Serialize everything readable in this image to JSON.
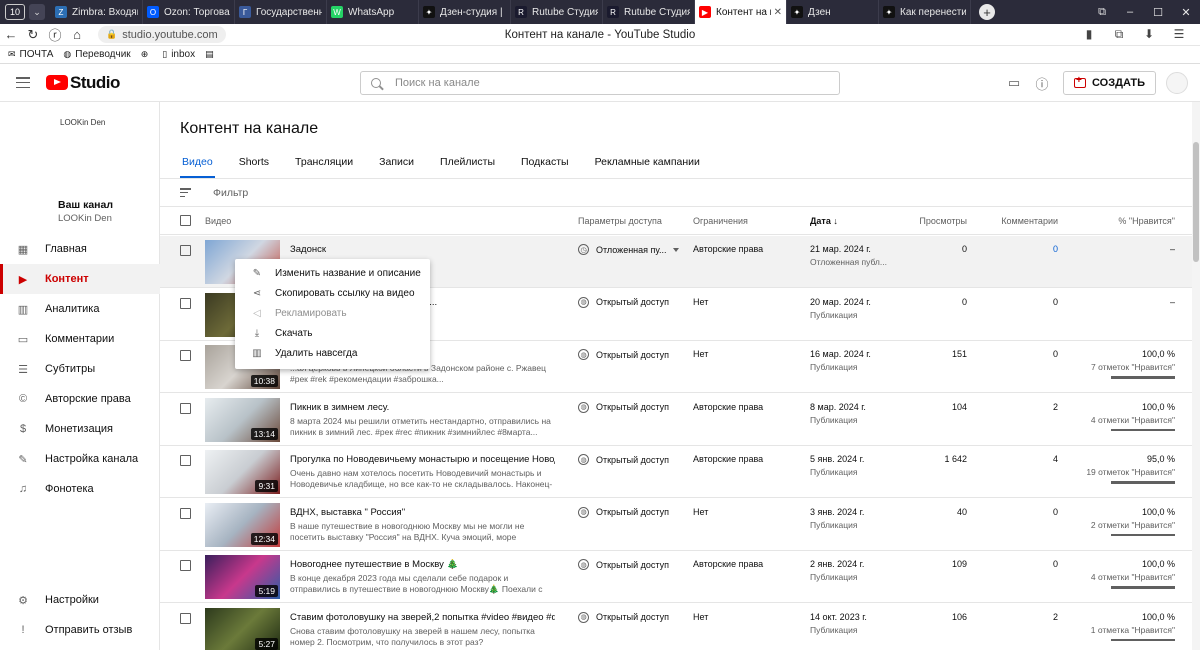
{
  "browser": {
    "tab_count": "10",
    "tabs": [
      {
        "label": "Zimbra: Входящи",
        "fav_color": "#2c6fb5",
        "fav_glyph": "Z",
        "active": false
      },
      {
        "label": "Ozon: Торговая п",
        "fav_color": "#005bff",
        "fav_glyph": "O",
        "active": false
      },
      {
        "label": "Государственная",
        "fav_color": "#3a5a9b",
        "fav_glyph": "Г",
        "active": false
      },
      {
        "label": "WhatsApp",
        "fav_color": "#25d366",
        "fav_glyph": "W",
        "active": false
      },
      {
        "label": "Дзен-студия | Ка",
        "fav_color": "#111111",
        "fav_glyph": "✦",
        "active": false
      },
      {
        "label": "Rutube Студия",
        "fav_color": "#1a1a2e",
        "fav_glyph": "R",
        "active": false
      },
      {
        "label": "Rutube Студия",
        "fav_color": "#1a1a2e",
        "fav_glyph": "R",
        "active": false
      },
      {
        "label": "Контент на кан",
        "fav_color": "#ff0000",
        "fav_glyph": "▶",
        "active": true
      },
      {
        "label": "Дзен",
        "fav_color": "#111111",
        "fav_glyph": "✦",
        "active": false
      },
      {
        "label": "Как перенести св",
        "fav_color": "#111111",
        "fav_glyph": "✦",
        "active": false
      }
    ],
    "url": "studio.youtube.com",
    "page_title": "Контент на канале - YouTube Studio",
    "bookmarks": [
      "ПОЧТА",
      "Переводчик",
      "",
      "inbox"
    ]
  },
  "header": {
    "logo_text": "Studio",
    "search_placeholder": "Поиск на канале",
    "create_label": "СОЗДАТЬ"
  },
  "sidebar": {
    "channel_avatar_text": "LOOKin Den",
    "channel_label": "Ваш канал",
    "channel_name": "LOOKin Den",
    "items": [
      {
        "label": "Главная",
        "icon": "dashboard-icon",
        "glyph": "▦",
        "active": false
      },
      {
        "label": "Контент",
        "icon": "content-icon",
        "glyph": "▶",
        "active": true
      },
      {
        "label": "Аналитика",
        "icon": "analytics-icon",
        "glyph": "▥",
        "active": false
      },
      {
        "label": "Комментарии",
        "icon": "comments-icon",
        "glyph": "▭",
        "active": false
      },
      {
        "label": "Субтитры",
        "icon": "subtitles-icon",
        "glyph": "☰",
        "active": false
      },
      {
        "label": "Авторские права",
        "icon": "copyright-icon",
        "glyph": "©",
        "active": false
      },
      {
        "label": "Монетизация",
        "icon": "monetization-icon",
        "glyph": "$",
        "active": false
      },
      {
        "label": "Настройка канала",
        "icon": "customization-icon",
        "glyph": "✎",
        "active": false
      },
      {
        "label": "Фонотека",
        "icon": "audio-library-icon",
        "glyph": "♫",
        "active": false
      }
    ],
    "bottom": [
      {
        "label": "Настройки",
        "icon": "settings-icon",
        "glyph": "⚙"
      },
      {
        "label": "Отправить отзыв",
        "icon": "feedback-icon",
        "glyph": "!"
      }
    ]
  },
  "main": {
    "title": "Контент на канале",
    "tabs": [
      "Видео",
      "Shorts",
      "Трансляции",
      "Записи",
      "Плейлисты",
      "Подкасты",
      "Рекламные кампании"
    ],
    "filter_label": "Фильтр",
    "columns": {
      "video": "Видео",
      "access": "Параметры доступа",
      "restrictions": "Ограничения",
      "date": "Дата",
      "views": "Просмотры",
      "comments": "Комментарии",
      "likes": "% \"Нравится\""
    },
    "rows": [
      {
        "title": "Задонск",
        "desc": "",
        "duration": "",
        "access": "Отложенная пу...",
        "access_icon": "◷",
        "restrictions": "Авторские права",
        "date": "21 мар. 2024 г.",
        "date_sub": "Отложенная публ...",
        "views": "0",
        "comments": "0",
        "likes": "–",
        "likes_sub": "",
        "hover": true
      },
      {
        "title": "...ская ГЭС, Кураповские скалы...",
        "desc": "...3 минуты",
        "duration": "",
        "access": "Открытый доступ",
        "access_icon": "◍",
        "restrictions": "Нет",
        "date": "20 мар. 2024 г.",
        "date_sub": "Публикация",
        "views": "0",
        "comments": "0",
        "likes": "–",
        "likes_sub": "",
        "hover": false
      },
      {
        "title": "...",
        "desc": "...ая церковь в Липецкой области в Задонском районе с. Ржавец #рек #rek #рекомендации #заброшка...",
        "duration": "10:38",
        "access": "Открытый доступ",
        "access_icon": "◍",
        "restrictions": "Нет",
        "date": "16 мар. 2024 г.",
        "date_sub": "Публикация",
        "views": "151",
        "comments": "0",
        "likes": "100,0 %",
        "likes_sub": "7 отметок \"Нравится\"",
        "hover": false
      },
      {
        "title": "Пикник в зимнем лесу.",
        "desc": "8 марта 2024 мы решили отметить нестандартно, отправились на пикник в зимний лес. #рек #rec #пикник #зимнийлес #8марта...",
        "duration": "13:14",
        "access": "Открытый доступ",
        "access_icon": "◍",
        "restrictions": "Авторские права",
        "date": "8 мар. 2024 г.",
        "date_sub": "Публикация",
        "views": "104",
        "comments": "2",
        "likes": "100,0 %",
        "likes_sub": "4 отметки \"Нравится\"",
        "hover": false
      },
      {
        "title": "Прогулка по Новодевичьему монастырю и посещение Новодевичь...",
        "desc": "Очень давно нам хотелось посетить Новодевичий монастырь и Новодевичье кладбище, но все как-то не складывалось. Наконец-то вс...",
        "duration": "9:31",
        "access": "Открытый доступ",
        "access_icon": "◍",
        "restrictions": "Авторские права",
        "date": "5 янв. 2024 г.",
        "date_sub": "Публикация",
        "views": "1 642",
        "comments": "4",
        "likes": "95,0 %",
        "likes_sub": "19 отметок \"Нравится\"",
        "hover": false
      },
      {
        "title": "ВДНХ, выставка \" Россия\"",
        "desc": "В наше путешествие в новогоднюю Москву мы не могли не посетить выставку \"Россия\" на ВДНХ. Куча эмоций, море впечатлений! Это было...",
        "duration": "12:34",
        "access": "Открытый доступ",
        "access_icon": "◍",
        "restrictions": "Нет",
        "date": "3 янв. 2024 г.",
        "date_sub": "Публикация",
        "views": "40",
        "comments": "0",
        "likes": "100,0 %",
        "likes_sub": "2 отметки \"Нравится\"",
        "hover": false
      },
      {
        "title": "Новогоднее путешествие в Москву 🎄",
        "desc": "В конце декабря 2023 года мы сделали себе подарок и отправились в путешествие в новогоднюю Москву🎄 Поехали с нами 😉 #rek #winter...",
        "duration": "5:19",
        "access": "Открытый доступ",
        "access_icon": "◍",
        "restrictions": "Авторские права",
        "date": "2 янв. 2024 г.",
        "date_sub": "Публикация",
        "views": "109",
        "comments": "0",
        "likes": "100,0 %",
        "likes_sub": "4 отметки \"Нравится\"",
        "hover": false
      },
      {
        "title": "Ставим фотоловушку на зверей,2 попытка #video #видео #фотоло...",
        "desc": "Снова ставим фотоловушку на зверей в нашем лесу, попытка номер 2. Посмотрим, что получилось в этот раз?",
        "duration": "5:27",
        "access": "Открытый доступ",
        "access_icon": "◍",
        "restrictions": "Нет",
        "date": "14 окт. 2023 г.",
        "date_sub": "Публикация",
        "views": "106",
        "comments": "2",
        "likes": "100,0 %",
        "likes_sub": "1 отметка \"Нравится\"",
        "hover": false
      }
    ]
  },
  "context_menu": {
    "items": [
      {
        "label": "Изменить название и описание",
        "icon": "pencil-icon",
        "glyph": "✎",
        "disabled": false
      },
      {
        "label": "Скопировать ссылку на видео",
        "icon": "share-icon",
        "glyph": "⋖",
        "disabled": false
      },
      {
        "label": "Рекламировать",
        "icon": "promote-icon",
        "glyph": "◁",
        "disabled": true
      },
      {
        "label": "Скачать",
        "icon": "download-icon",
        "glyph": "⤓",
        "disabled": false
      },
      {
        "label": "Удалить навсегда",
        "icon": "trash-icon",
        "glyph": "▥",
        "disabled": false
      }
    ]
  },
  "colors": {
    "accent_red": "#cc0000",
    "link_blue": "#065fd4"
  }
}
